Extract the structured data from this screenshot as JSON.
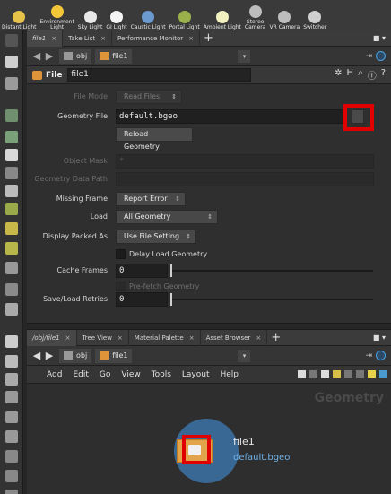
{
  "shelf": [
    {
      "label": "Distant Light",
      "icon": "distant-light-icon",
      "color": "#e6c24a"
    },
    {
      "label": "Environment\nLight",
      "icon": "environment-light-icon",
      "color": "#f2c83a"
    },
    {
      "label": "Sky Light",
      "icon": "sky-light-icon",
      "color": "#e8e8e8"
    },
    {
      "label": "GI Light",
      "icon": "gi-light-icon",
      "color": "#f4f4f4"
    },
    {
      "label": "Caustic Light",
      "icon": "caustic-light-icon",
      "color": "#6a9ad0"
    },
    {
      "label": "Portal Light",
      "icon": "portal-light-icon",
      "color": "#9ab04a"
    },
    {
      "label": "Ambient Light",
      "icon": "ambient-light-icon",
      "color": "#f2f2c0"
    },
    {
      "label": "Stereo\nCamera",
      "icon": "stereo-camera-icon",
      "color": "#bdbdbd"
    },
    {
      "label": "VR Camera",
      "icon": "vr-camera-icon",
      "color": "#bdbdbd"
    },
    {
      "label": "Switcher",
      "icon": "switcher-icon",
      "color": "#cfcfcf"
    }
  ],
  "top_pane": {
    "tabs": [
      {
        "label": "file1",
        "active": true
      },
      {
        "label": "Take List",
        "active": false
      },
      {
        "label": "Performance Monitor",
        "active": false
      }
    ],
    "path": {
      "context": "obj",
      "node": "file1"
    }
  },
  "parm_header": {
    "type_label": "File",
    "node_name": "file1"
  },
  "parms": {
    "file_mode": {
      "label": "File Mode",
      "value": "Read Files"
    },
    "geometry_file": {
      "label": "Geometry File",
      "value": "default.bgeo"
    },
    "reload_button": "Reload Geometry",
    "object_mask": {
      "label": "Object Mask",
      "value": "*"
    },
    "geometry_data_path": {
      "label": "Geometry Data Path",
      "value": ""
    },
    "missing_frame": {
      "label": "Missing Frame",
      "value": "Report Error"
    },
    "load": {
      "label": "Load",
      "value": "All Geometry"
    },
    "display_packed_as": {
      "label": "Display Packed As",
      "value": "Use File Setting"
    },
    "delay_load": {
      "label": "Delay Load Geometry"
    },
    "cache_frames": {
      "label": "Cache Frames",
      "value": "0"
    },
    "prefetch": {
      "label": "Pre-fetch Geometry"
    },
    "save_load_retries": {
      "label": "Save/Load Retries",
      "value": "0"
    }
  },
  "bottom_pane": {
    "tabs": [
      {
        "label": "/obj/file1",
        "active": true
      },
      {
        "label": "Tree View",
        "active": false
      },
      {
        "label": "Material Palette",
        "active": false
      },
      {
        "label": "Asset Browser",
        "active": false
      }
    ],
    "path": {
      "context": "obj",
      "node": "file1"
    },
    "menu": [
      "Add",
      "Edit",
      "Go",
      "View",
      "Tools",
      "Layout",
      "Help"
    ],
    "watermark": "Geometry",
    "node": {
      "name": "file1",
      "file": "default.bgeo"
    }
  },
  "colors": {
    "highlight": "#e00000",
    "node_ring": "#3a6c9a",
    "node_body": "#e2a34b",
    "file_text": "#6fb1e8"
  }
}
